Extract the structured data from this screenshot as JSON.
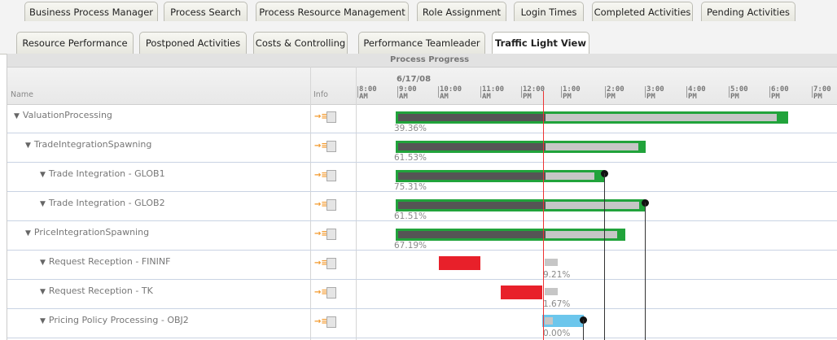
{
  "tabs_row1": [
    "Business Process Manager",
    "Process Search",
    "Process Resource Management",
    "Role Assignment",
    "Login Times",
    "Completed Activities",
    "Pending Activities"
  ],
  "tabs_row2": [
    "Resource Performance",
    "Postponed Activities",
    "Costs & Controlling",
    "Performance Teamleader",
    "Traffic Light View"
  ],
  "active_tab": "Traffic Light View",
  "header": {
    "title": "Process Progress",
    "date": "6/17/08",
    "name_col": "Name",
    "info_col": "Info",
    "ticks": [
      [
        "8:00",
        "AM"
      ],
      [
        "9:00",
        "AM"
      ],
      [
        "10:00",
        "AM"
      ],
      [
        "11:00",
        "AM"
      ],
      [
        "12:00",
        "PM"
      ],
      [
        "1:00",
        "PM"
      ],
      [
        "2:00",
        "PM"
      ],
      [
        "3:00",
        "PM"
      ],
      [
        "4:00",
        "PM"
      ],
      [
        "5:00",
        "PM"
      ],
      [
        "6:00",
        "PM"
      ],
      [
        "7:00",
        "PM"
      ]
    ]
  },
  "colors": {
    "on_track": "#21a33b",
    "late": "#e8202a",
    "pending": "#6cc6ec",
    "now_line": "#e33333"
  },
  "rows": [
    {
      "name": "ValuationProcessing",
      "level": 0,
      "pct": "39.36%",
      "status": "green"
    },
    {
      "name": "TradeIntegrationSpawning",
      "level": 1,
      "pct": "61.53%",
      "status": "green"
    },
    {
      "name": "Trade Integration - GLOB1",
      "level": 2,
      "pct": "75.31%",
      "status": "green"
    },
    {
      "name": "Trade Integration - GLOB2",
      "level": 2,
      "pct": "61.51%",
      "status": "green"
    },
    {
      "name": "PriceIntegrationSpawning",
      "level": 1,
      "pct": "67.19%",
      "status": "green"
    },
    {
      "name": "Request Reception - FININF",
      "level": 2,
      "pct": "9.21%",
      "status": "red"
    },
    {
      "name": "Request Reception - TK",
      "level": 2,
      "pct": "1.67%",
      "status": "red"
    },
    {
      "name": "Pricing Policy Processing - OBJ2",
      "level": 2,
      "pct": "0.00%",
      "status": "blue"
    }
  ]
}
